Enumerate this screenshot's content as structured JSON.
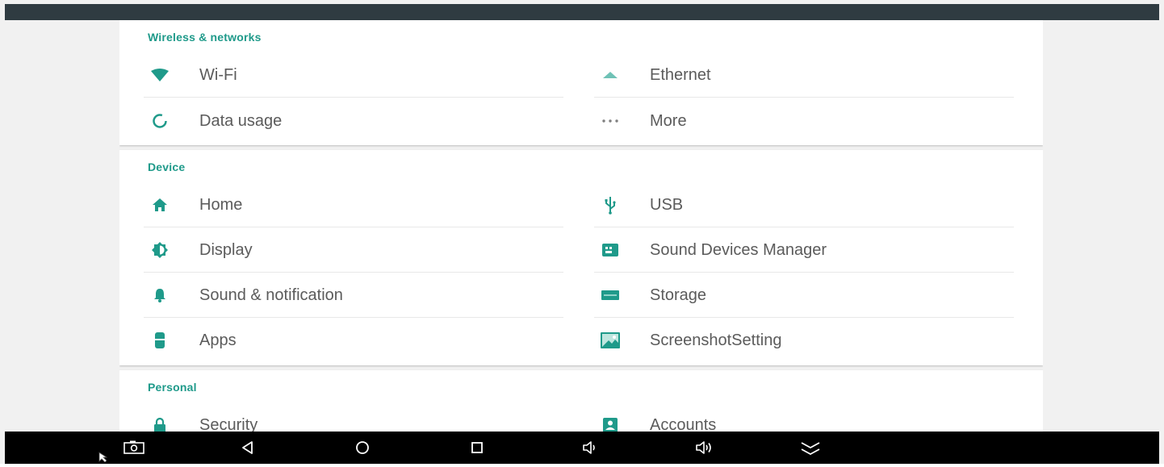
{
  "sections": [
    {
      "title": "Wireless & networks",
      "items": [
        {
          "label": "Wi-Fi",
          "icon": "wifi-icon"
        },
        {
          "label": "Ethernet",
          "icon": "ethernet-icon"
        },
        {
          "label": "Data usage",
          "icon": "data-usage-icon"
        },
        {
          "label": "More",
          "icon": "more-icon"
        }
      ]
    },
    {
      "title": "Device",
      "items": [
        {
          "label": "Home",
          "icon": "home-icon"
        },
        {
          "label": "USB",
          "icon": "usb-icon"
        },
        {
          "label": "Display",
          "icon": "display-brightness-icon"
        },
        {
          "label": "Sound Devices Manager",
          "icon": "sound-devices-icon"
        },
        {
          "label": "Sound & notification",
          "icon": "bell-icon"
        },
        {
          "label": "Storage",
          "icon": "storage-icon"
        },
        {
          "label": "Apps",
          "icon": "apps-icon"
        },
        {
          "label": "ScreenshotSetting",
          "icon": "screenshot-icon"
        }
      ]
    },
    {
      "title": "Personal",
      "items": [
        {
          "label": "Security",
          "icon": "lock-icon"
        },
        {
          "label": "Accounts",
          "icon": "account-icon"
        }
      ]
    }
  ],
  "navbar": {
    "buttons": [
      "screenshot-icon",
      "back-icon",
      "home-circle-icon",
      "recents-icon",
      "volume-down-icon",
      "volume-up-icon",
      "collapse-icon"
    ]
  },
  "colors": {
    "accent": "#1f9a8a",
    "label": "#5b5b5b",
    "divider": "#e8e8e8",
    "navbar": "#000000",
    "topbar": "#2f3b41"
  }
}
